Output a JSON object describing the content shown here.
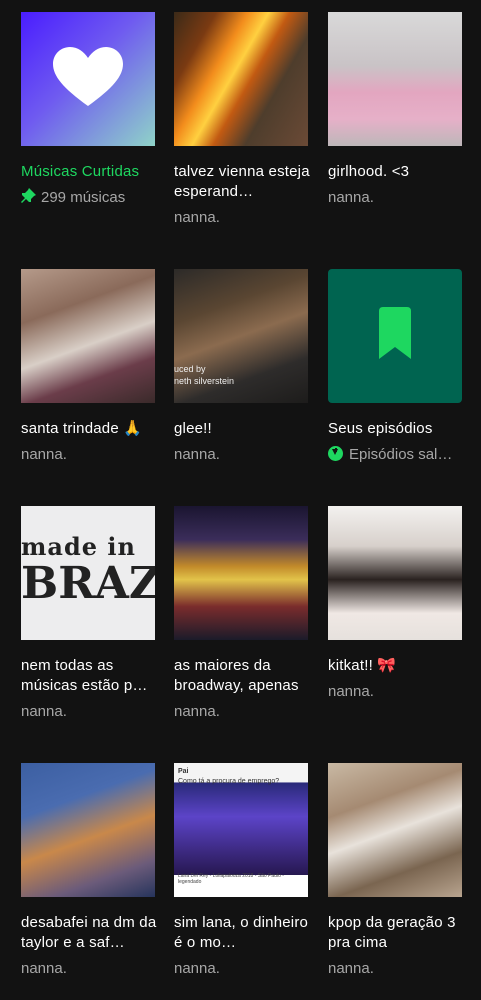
{
  "colors": {
    "background": "#121212",
    "accent": "#1ed760",
    "subtext": "#a7a7a7"
  },
  "library": [
    {
      "title": "Músicas Curtidas",
      "subtitle": "299 músicas",
      "title_color": "green",
      "icon": "pin-icon",
      "cover": "heart-icon"
    },
    {
      "title": "talvez vienna esteja esperand…",
      "subtitle": "nanna."
    },
    {
      "title": "girlhood. <3",
      "subtitle": "nanna."
    },
    {
      "title": "santa trindade 🙏",
      "subtitle": "nanna."
    },
    {
      "title": "glee!!",
      "subtitle": "nanna.",
      "cover_text": "uced by\nneth silverstein"
    },
    {
      "title": "Seus episódios",
      "subtitle": "Episódios sal…",
      "icon": "download-icon",
      "cover": "bookmark-icon"
    },
    {
      "title": "nem todas as músicas estão p…",
      "subtitle": "nanna.",
      "cover_text_1": "made in",
      "cover_text_2": "BRAZIL"
    },
    {
      "title": "as maiores da broadway, apenas",
      "subtitle": "nanna."
    },
    {
      "title": "kitkat!! 🎀",
      "subtitle": "nanna."
    },
    {
      "title": "desabafei na dm da taylor e a saf…",
      "subtitle": "nanna."
    },
    {
      "title": "sim lana, o dinheiro é o mo…",
      "subtitle": "nanna.",
      "cover_text": "Pai",
      "cover_sub": "Como tá a procura de emprego?",
      "cover_caption": "Lana Del Rey - Lollapalooza 2018 - São Paulo - legendado"
    },
    {
      "title": "kpop da geração 3 pra cima",
      "subtitle": "nanna."
    }
  ]
}
